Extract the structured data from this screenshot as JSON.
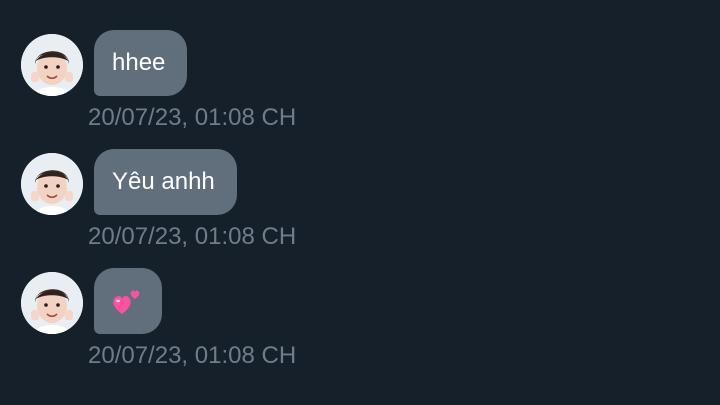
{
  "messages": [
    {
      "text": "hhee",
      "timestamp": "20/07/23, 01:08 CH",
      "emoji": ""
    },
    {
      "text": "Yêu anhh",
      "timestamp": "20/07/23, 01:08 CH",
      "emoji": ""
    },
    {
      "text": "",
      "timestamp": "20/07/23, 01:08 CH",
      "emoji": "two-hearts-icon"
    }
  ],
  "colors": {
    "background": "#16202b",
    "bubble": "#616f7d",
    "timestamp": "#6f7d8b",
    "text": "#ffffff",
    "heart": "#ff4fa3"
  }
}
